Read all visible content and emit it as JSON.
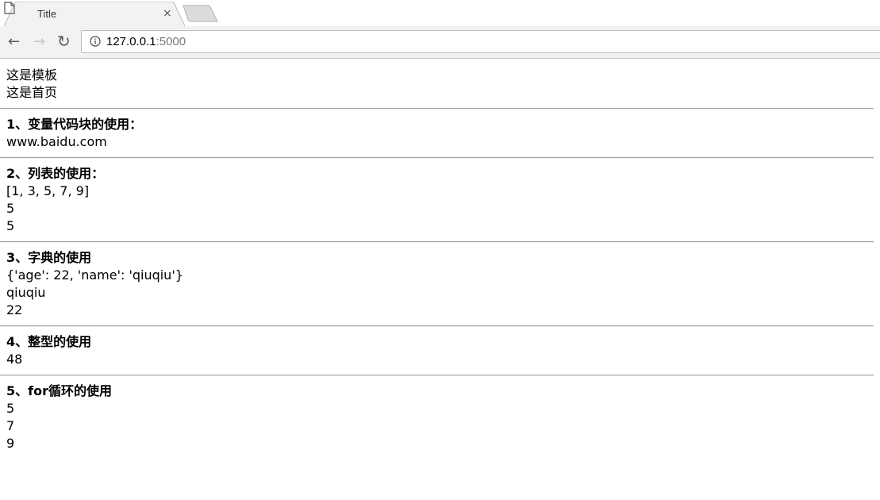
{
  "browser": {
    "tab_title": "Title",
    "tab_close": "×",
    "url_host": "127.0.0.1",
    "url_port": ":5000"
  },
  "page": {
    "lines_intro": [
      "这是模板",
      "这是首页"
    ],
    "sections": [
      {
        "heading": "1、变量代码块的使用：",
        "lines": [
          "www.baidu.com"
        ]
      },
      {
        "heading": "2、列表的使用：",
        "lines": [
          "[1, 3, 5, 7, 9]",
          "5",
          "5"
        ]
      },
      {
        "heading": "3、字典的使用",
        "lines": [
          "{'age': 22, 'name': 'qiuqiu'}",
          "qiuqiu",
          "22"
        ]
      },
      {
        "heading": "4、整型的使用",
        "lines": [
          "48"
        ]
      },
      {
        "heading": "5、for循环的使用",
        "lines": [
          "5",
          "7",
          "9"
        ]
      }
    ]
  },
  "colors": {
    "toolbar_bg": "#f2f2f2",
    "divider": "#a0a0a0"
  }
}
